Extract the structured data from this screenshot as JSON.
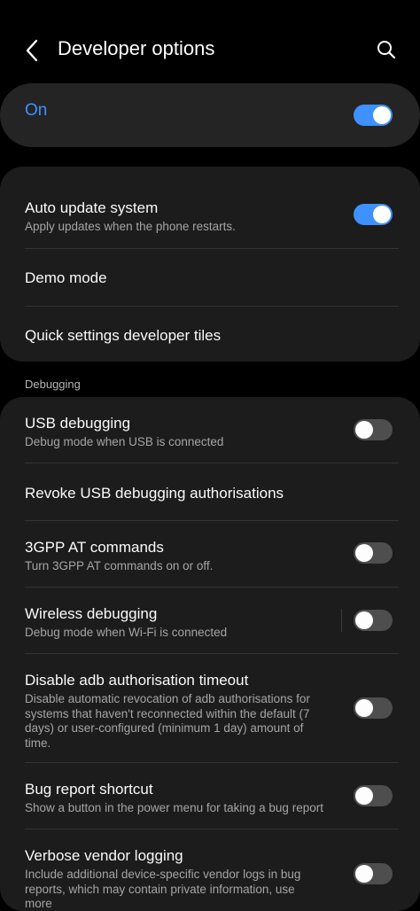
{
  "header": {
    "title": "Developer options"
  },
  "master": {
    "label": "On",
    "state": "on"
  },
  "group1": {
    "items": [
      {
        "title": "Auto update system",
        "subtitle": "Apply updates when the phone restarts.",
        "toggle": "on"
      },
      {
        "title": "Demo mode"
      },
      {
        "title": "Quick settings developer tiles"
      }
    ]
  },
  "section": {
    "label": "Debugging"
  },
  "group2": {
    "items": [
      {
        "title": "USB debugging",
        "subtitle": "Debug mode when USB is connected",
        "toggle": "off"
      },
      {
        "title": "Revoke USB debugging authorisations"
      },
      {
        "title": "3GPP AT commands",
        "subtitle": "Turn 3GPP AT commands on or off.",
        "toggle": "off"
      },
      {
        "title": "Wireless debugging",
        "subtitle": "Debug mode when Wi-Fi is connected",
        "toggle": "off"
      },
      {
        "title": "Disable adb authorisation timeout",
        "subtitle": "Disable automatic revocation of adb authorisations for systems that haven't reconnected within the default (7 days) or user-configured (minimum 1 day) amount of time.",
        "toggle": "off"
      },
      {
        "title": "Bug report shortcut",
        "subtitle": "Show a button in the power menu for taking a bug report",
        "toggle": "off"
      },
      {
        "title": "Verbose vendor logging",
        "subtitle": "Include additional device-specific vendor logs in bug reports, which may contain private information, use more",
        "toggle": "off"
      }
    ]
  },
  "colors": {
    "accent": "#3e91ff",
    "card": "#1c1c1c",
    "background": "#000000"
  },
  "icons": {
    "back": "chevron-left-icon",
    "search": "search-icon"
  }
}
